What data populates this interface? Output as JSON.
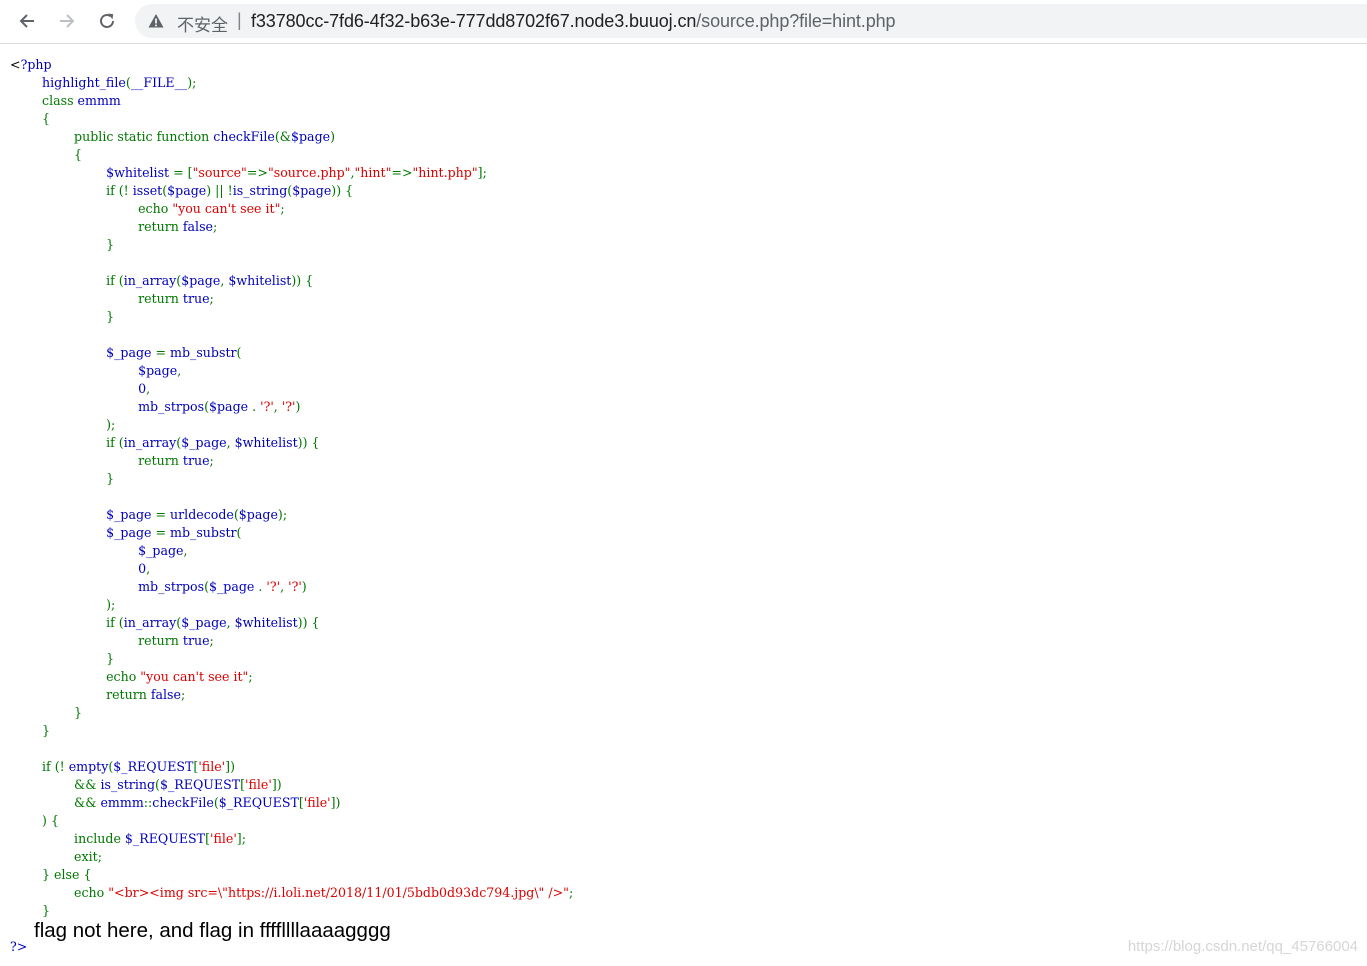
{
  "browser": {
    "insecure_label": "不安全",
    "separator": "|",
    "url_host": "f33780cc-7fd6-4f32-b63e-777dd8702f67.node3.buuoj.cn",
    "url_path": "/source.php?file=hint.php"
  },
  "source_code": {
    "language": "php",
    "lines": [
      [
        [
          "html",
          "<"
        ],
        [
          "default",
          "?php"
        ]
      ],
      [
        [
          "default",
          "        highlight_file"
        ],
        [
          "keyword",
          "("
        ],
        [
          "default",
          "__FILE__"
        ],
        [
          "keyword",
          ");"
        ]
      ],
      [
        [
          "keyword",
          "        class "
        ],
        [
          "default",
          "emmm"
        ]
      ],
      [
        [
          "keyword",
          "        {"
        ]
      ],
      [
        [
          "keyword",
          "                public static function "
        ],
        [
          "default",
          "checkFile"
        ],
        [
          "keyword",
          "(&"
        ],
        [
          "default",
          "$page"
        ],
        [
          "keyword",
          ")"
        ]
      ],
      [
        [
          "keyword",
          "                {"
        ]
      ],
      [
        [
          "default",
          "                        $whitelist "
        ],
        [
          "keyword",
          "= ["
        ],
        [
          "string",
          "\"source\""
        ],
        [
          "keyword",
          "=>"
        ],
        [
          "string",
          "\"source.php\""
        ],
        [
          "keyword",
          ","
        ],
        [
          "string",
          "\"hint\""
        ],
        [
          "keyword",
          "=>"
        ],
        [
          "string",
          "\"hint.php\""
        ],
        [
          "keyword",
          "];"
        ]
      ],
      [
        [
          "keyword",
          "                        if (! "
        ],
        [
          "default",
          "isset"
        ],
        [
          "keyword",
          "("
        ],
        [
          "default",
          "$page"
        ],
        [
          "keyword",
          ") || !"
        ],
        [
          "default",
          "is_string"
        ],
        [
          "keyword",
          "("
        ],
        [
          "default",
          "$page"
        ],
        [
          "keyword",
          ")) {"
        ]
      ],
      [
        [
          "keyword",
          "                                echo "
        ],
        [
          "string",
          "\"you can't see it\""
        ],
        [
          "keyword",
          ";"
        ]
      ],
      [
        [
          "keyword",
          "                                return "
        ],
        [
          "default",
          "false"
        ],
        [
          "keyword",
          ";"
        ]
      ],
      [
        [
          "keyword",
          "                        }"
        ]
      ],
      [],
      [
        [
          "keyword",
          "                        if ("
        ],
        [
          "default",
          "in_array"
        ],
        [
          "keyword",
          "("
        ],
        [
          "default",
          "$page"
        ],
        [
          "keyword",
          ", "
        ],
        [
          "default",
          "$whitelist"
        ],
        [
          "keyword",
          ")) {"
        ]
      ],
      [
        [
          "keyword",
          "                                return "
        ],
        [
          "default",
          "true"
        ],
        [
          "keyword",
          ";"
        ]
      ],
      [
        [
          "keyword",
          "                        }"
        ]
      ],
      [],
      [
        [
          "default",
          "                        $_page "
        ],
        [
          "keyword",
          "= "
        ],
        [
          "default",
          "mb_substr"
        ],
        [
          "keyword",
          "("
        ]
      ],
      [
        [
          "default",
          "                                $page"
        ],
        [
          "keyword",
          ","
        ]
      ],
      [
        [
          "default",
          "                                0"
        ],
        [
          "keyword",
          ","
        ]
      ],
      [
        [
          "default",
          "                                mb_strpos"
        ],
        [
          "keyword",
          "("
        ],
        [
          "default",
          "$page "
        ],
        [
          "keyword",
          ". "
        ],
        [
          "string",
          "'?'"
        ],
        [
          "keyword",
          ", "
        ],
        [
          "string",
          "'?'"
        ],
        [
          "keyword",
          ")"
        ]
      ],
      [
        [
          "keyword",
          "                        );"
        ]
      ],
      [
        [
          "keyword",
          "                        if ("
        ],
        [
          "default",
          "in_array"
        ],
        [
          "keyword",
          "("
        ],
        [
          "default",
          "$_page"
        ],
        [
          "keyword",
          ", "
        ],
        [
          "default",
          "$whitelist"
        ],
        [
          "keyword",
          ")) {"
        ]
      ],
      [
        [
          "keyword",
          "                                return "
        ],
        [
          "default",
          "true"
        ],
        [
          "keyword",
          ";"
        ]
      ],
      [
        [
          "keyword",
          "                        }"
        ]
      ],
      [],
      [
        [
          "default",
          "                        $_page "
        ],
        [
          "keyword",
          "= "
        ],
        [
          "default",
          "urldecode"
        ],
        [
          "keyword",
          "("
        ],
        [
          "default",
          "$page"
        ],
        [
          "keyword",
          ");"
        ]
      ],
      [
        [
          "default",
          "                        $_page "
        ],
        [
          "keyword",
          "= "
        ],
        [
          "default",
          "mb_substr"
        ],
        [
          "keyword",
          "("
        ]
      ],
      [
        [
          "default",
          "                                $_page"
        ],
        [
          "keyword",
          ","
        ]
      ],
      [
        [
          "default",
          "                                0"
        ],
        [
          "keyword",
          ","
        ]
      ],
      [
        [
          "default",
          "                                mb_strpos"
        ],
        [
          "keyword",
          "("
        ],
        [
          "default",
          "$_page "
        ],
        [
          "keyword",
          ". "
        ],
        [
          "string",
          "'?'"
        ],
        [
          "keyword",
          ", "
        ],
        [
          "string",
          "'?'"
        ],
        [
          "keyword",
          ")"
        ]
      ],
      [
        [
          "keyword",
          "                        );"
        ]
      ],
      [
        [
          "keyword",
          "                        if ("
        ],
        [
          "default",
          "in_array"
        ],
        [
          "keyword",
          "("
        ],
        [
          "default",
          "$_page"
        ],
        [
          "keyword",
          ", "
        ],
        [
          "default",
          "$whitelist"
        ],
        [
          "keyword",
          ")) {"
        ]
      ],
      [
        [
          "keyword",
          "                                return "
        ],
        [
          "default",
          "true"
        ],
        [
          "keyword",
          ";"
        ]
      ],
      [
        [
          "keyword",
          "                        }"
        ]
      ],
      [
        [
          "keyword",
          "                        echo "
        ],
        [
          "string",
          "\"you can't see it\""
        ],
        [
          "keyword",
          ";"
        ]
      ],
      [
        [
          "keyword",
          "                        return "
        ],
        [
          "default",
          "false"
        ],
        [
          "keyword",
          ";"
        ]
      ],
      [
        [
          "keyword",
          "                }"
        ]
      ],
      [
        [
          "keyword",
          "        }"
        ]
      ],
      [],
      [
        [
          "keyword",
          "        if (! "
        ],
        [
          "default",
          "empty"
        ],
        [
          "keyword",
          "("
        ],
        [
          "default",
          "$_REQUEST"
        ],
        [
          "keyword",
          "["
        ],
        [
          "string",
          "'file'"
        ],
        [
          "keyword",
          "])"
        ]
      ],
      [
        [
          "keyword",
          "                && "
        ],
        [
          "default",
          "is_string"
        ],
        [
          "keyword",
          "("
        ],
        [
          "default",
          "$_REQUEST"
        ],
        [
          "keyword",
          "["
        ],
        [
          "string",
          "'file'"
        ],
        [
          "keyword",
          "])"
        ]
      ],
      [
        [
          "keyword",
          "                && "
        ],
        [
          "default",
          "emmm"
        ],
        [
          "keyword",
          "::"
        ],
        [
          "default",
          "checkFile"
        ],
        [
          "keyword",
          "("
        ],
        [
          "default",
          "$_REQUEST"
        ],
        [
          "keyword",
          "["
        ],
        [
          "string",
          "'file'"
        ],
        [
          "keyword",
          "])"
        ]
      ],
      [
        [
          "keyword",
          "        ) {"
        ]
      ],
      [
        [
          "keyword",
          "                include "
        ],
        [
          "default",
          "$_REQUEST"
        ],
        [
          "keyword",
          "["
        ],
        [
          "string",
          "'file'"
        ],
        [
          "keyword",
          "];"
        ]
      ],
      [
        [
          "keyword",
          "                exit;"
        ]
      ],
      [
        [
          "keyword",
          "        } else {"
        ]
      ],
      [
        [
          "keyword",
          "                echo "
        ],
        [
          "string",
          "\"<br><img src=\\\"https://i.loli.net/2018/11/01/5bdb0d93dc794.jpg\\\" />\""
        ],
        [
          "keyword",
          ";"
        ]
      ],
      [
        [
          "keyword",
          "        }"
        ]
      ],
      []
    ],
    "closing_tag": "?>"
  },
  "page_output": {
    "text": "flag not here, and flag in ffffllllaaaagggg"
  },
  "watermark": {
    "text": "https://blog.csdn.net/qq_45766004"
  },
  "colors": {
    "php_default": "#0000bb",
    "php_keyword": "#007700",
    "php_string": "#dd0000",
    "php_html": "#000000"
  }
}
